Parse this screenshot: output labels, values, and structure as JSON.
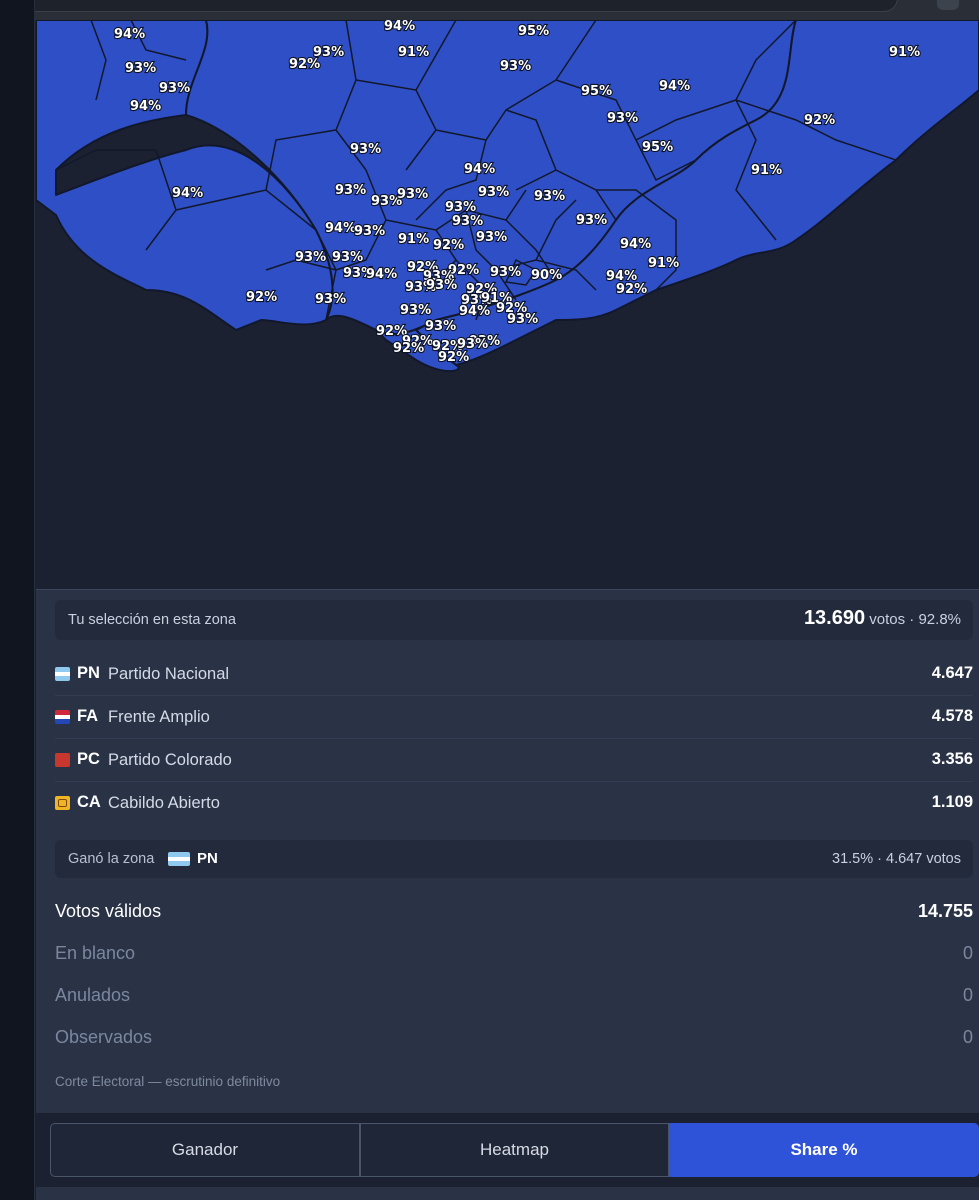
{
  "map": {
    "fill_color": "#2f4fc7",
    "border_color": "#12182b",
    "label_color": "#ffffff",
    "labels": [
      "94%",
      "94%",
      "95%",
      "91%",
      "93%",
      "92%",
      "91%",
      "93%",
      "93%",
      "93%",
      "95%",
      "94%",
      "94%",
      "93%",
      "92%",
      "93%",
      "95%",
      "91%",
      "94%",
      "94%",
      "93%",
      "93%",
      "93%",
      "93%",
      "93%",
      "93%",
      "93%",
      "93%",
      "94%",
      "93%",
      "91%",
      "92%",
      "93%",
      "94%",
      "93%",
      "93%",
      "92%",
      "92%",
      "93%",
      "94%",
      "93%",
      "90%",
      "94%",
      "91%",
      "93%",
      "92%",
      "92%",
      "93%",
      "93%",
      "93%",
      "91%",
      "93%",
      "94%",
      "92%",
      "93%",
      "92%",
      "93%",
      "93%",
      "92%",
      "93%",
      "92%",
      "92%",
      "92%",
      "93%",
      "92%"
    ]
  },
  "selection": {
    "label": "Tu selección en esta zona",
    "votes_number": "13.690",
    "votes_suffix": "votos · 92.8%"
  },
  "parties": [
    {
      "abbr": "PN",
      "name": "Partido Nacional",
      "votes": "4.647",
      "icon": "pn-flag-icon"
    },
    {
      "abbr": "FA",
      "name": "Frente Amplio",
      "votes": "4.578",
      "icon": "fa-flag-icon"
    },
    {
      "abbr": "PC",
      "name": "Partido Colorado",
      "votes": "3.356",
      "icon": "pc-flag-icon"
    },
    {
      "abbr": "CA",
      "name": "Cabildo Abierto",
      "votes": "1.109",
      "icon": "ca-flag-icon"
    }
  ],
  "winner": {
    "label": "Ganó la zona",
    "abbr": "PN",
    "summary": "31.5% · 4.647 votos"
  },
  "totals": {
    "valid_label": "Votos válidos",
    "valid_value": "14.755",
    "blank_label": "En blanco",
    "blank_value": "0",
    "null_label": "Anulados",
    "null_value": "0",
    "observed_label": "Observados",
    "observed_value": "0"
  },
  "source": "Corte Electoral — escrutinio definitivo",
  "tabs": {
    "winner": "Ganador",
    "heatmap": "Heatmap",
    "share": "Share %",
    "active": "share"
  },
  "colors": {
    "pn": [
      "#8fc9ee",
      "#ffffff",
      "#8fc9ee"
    ],
    "fa": [
      "#d0283b",
      "#ffffff",
      "#2547b5"
    ],
    "pc": "#c8372d",
    "ca": "#f1b523",
    "accent": "#2f53d8"
  }
}
